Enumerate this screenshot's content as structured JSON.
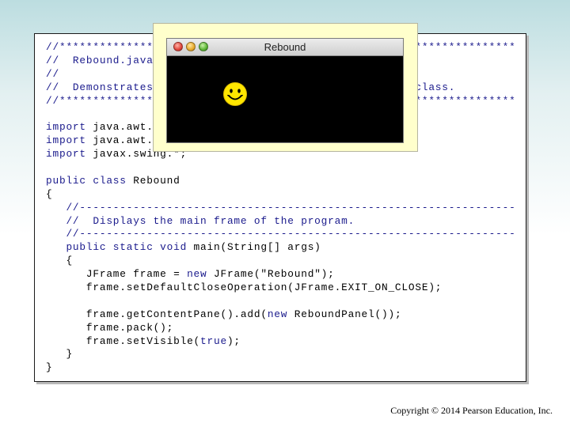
{
  "code_lines": [
    [
      {
        "cls": "t-comment",
        "text": "//********************************************************************"
      }
    ],
    [
      {
        "cls": "t-comment",
        "text": "//  Rebound.java       Author: Lewis/Loftus"
      }
    ],
    [
      {
        "cls": "t-comment",
        "text": "//"
      }
    ],
    [
      {
        "cls": "t-comment",
        "text": "//  Demonstrates an animation and the use of the Timer class."
      }
    ],
    [
      {
        "cls": "t-comment",
        "text": "//********************************************************************"
      }
    ],
    [
      {
        "cls": "t-plain",
        "text": ""
      }
    ],
    [
      {
        "cls": "t-kw",
        "text": "import"
      },
      {
        "cls": "t-plain",
        "text": " java.awt.*;"
      }
    ],
    [
      {
        "cls": "t-kw",
        "text": "import"
      },
      {
        "cls": "t-plain",
        "text": " java.awt.event.*;"
      }
    ],
    [
      {
        "cls": "t-kw",
        "text": "import"
      },
      {
        "cls": "t-plain",
        "text": " javax.swing.*;"
      }
    ],
    [
      {
        "cls": "t-plain",
        "text": ""
      }
    ],
    [
      {
        "cls": "t-kw",
        "text": "public class"
      },
      {
        "cls": "t-plain",
        "text": " Rebound"
      }
    ],
    [
      {
        "cls": "t-plain",
        "text": "{"
      }
    ],
    [
      {
        "cls": "t-comment",
        "text": "   //-----------------------------------------------------------------"
      }
    ],
    [
      {
        "cls": "t-comment",
        "text": "   //  Displays the main frame of the program."
      }
    ],
    [
      {
        "cls": "t-comment",
        "text": "   //-----------------------------------------------------------------"
      }
    ],
    [
      {
        "cls": "t-kw",
        "text": "   public static void"
      },
      {
        "cls": "t-plain",
        "text": " main(String[] args)"
      }
    ],
    [
      {
        "cls": "t-plain",
        "text": "   {"
      }
    ],
    [
      {
        "cls": "t-plain",
        "text": "      JFrame frame = "
      },
      {
        "cls": "t-kw",
        "text": "new"
      },
      {
        "cls": "t-plain",
        "text": " JFrame(\"Rebound\");"
      }
    ],
    [
      {
        "cls": "t-plain",
        "text": "      frame.setDefaultCloseOperation(JFrame.EXIT_ON_CLOSE);"
      }
    ],
    [
      {
        "cls": "t-plain",
        "text": ""
      }
    ],
    [
      {
        "cls": "t-plain",
        "text": "      frame.getContentPane().add("
      },
      {
        "cls": "t-kw",
        "text": "new"
      },
      {
        "cls": "t-plain",
        "text": " ReboundPanel());"
      }
    ],
    [
      {
        "cls": "t-plain",
        "text": "      frame.pack();"
      }
    ],
    [
      {
        "cls": "t-plain",
        "text": "      frame.setVisible("
      },
      {
        "cls": "t-kw",
        "text": "true"
      },
      {
        "cls": "t-plain",
        "text": ");"
      }
    ],
    [
      {
        "cls": "t-plain",
        "text": "   }"
      }
    ],
    [
      {
        "cls": "t-plain",
        "text": "}"
      }
    ]
  ],
  "window": {
    "title": "Rebound",
    "controls": [
      "close-button",
      "minimize-button",
      "zoom-button"
    ],
    "background": "#000000"
  },
  "smiley": {
    "icon": "smiley-face-icon",
    "color": "#ffe600"
  },
  "colors": {
    "keyword": "#1a1a8c",
    "comment": "#1a1a8c",
    "overlay": "#ffffcc"
  },
  "footer": {
    "copyright": "Copyright © 2014 Pearson Education, Inc."
  }
}
